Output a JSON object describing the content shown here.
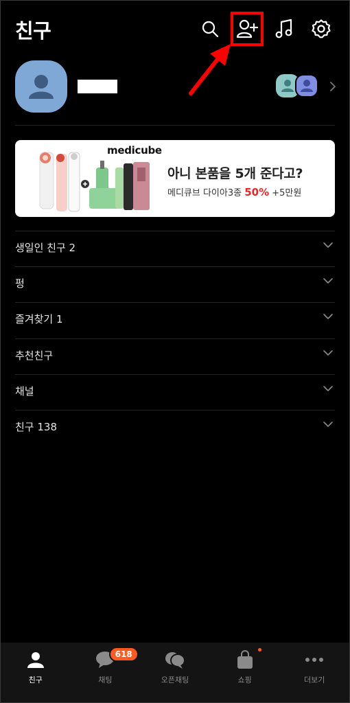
{
  "header": {
    "title": "친구",
    "icons": [
      "search-icon",
      "add-friend-icon",
      "music-icon",
      "settings-icon"
    ]
  },
  "profile": {
    "avatar_color": "#7fa8d6",
    "multiprofile_colors": [
      "#8ec9c6",
      "#7f8ee0"
    ]
  },
  "banner": {
    "brand": "medicube",
    "headline": "아니 본품을 5개 준다고?",
    "sub_prefix": "메디큐브 다이아3종 ",
    "sub_percent": "50%",
    "sub_suffix": " +5만원"
  },
  "sections": [
    {
      "label": "생일인 친구 2"
    },
    {
      "label": "펑"
    },
    {
      "label": "즐겨찾기 1"
    },
    {
      "label": "추천친구"
    },
    {
      "label": "채널"
    },
    {
      "label": "친구 138"
    }
  ],
  "bottom_nav": {
    "items": [
      {
        "label": "친구",
        "icon": "person-icon",
        "active": true
      },
      {
        "label": "채팅",
        "icon": "chat-bubble-icon",
        "badge": "618"
      },
      {
        "label": "오픈채팅",
        "icon": "open-chat-icon"
      },
      {
        "label": "쇼핑",
        "icon": "shopping-bag-icon",
        "dot": true
      },
      {
        "label": "더보기",
        "icon": "more-dots-icon"
      }
    ]
  },
  "colors": {
    "background": "#000000",
    "highlight": "#ff0000",
    "badge": "#ff5a1f",
    "accent_red": "#e8262a"
  }
}
